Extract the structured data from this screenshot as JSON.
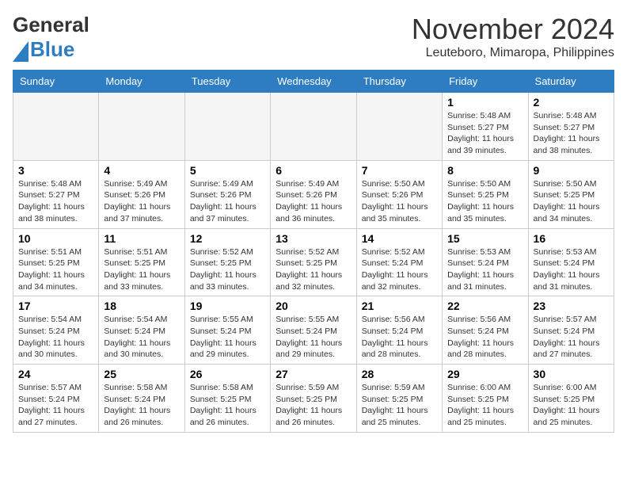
{
  "header": {
    "logo_line1": "General",
    "logo_line2": "Blue",
    "month": "November 2024",
    "location": "Leuteboro, Mimaropa, Philippines"
  },
  "days_of_week": [
    "Sunday",
    "Monday",
    "Tuesday",
    "Wednesday",
    "Thursday",
    "Friday",
    "Saturday"
  ],
  "weeks": [
    [
      {
        "day": "",
        "empty": true
      },
      {
        "day": "",
        "empty": true
      },
      {
        "day": "",
        "empty": true
      },
      {
        "day": "",
        "empty": true
      },
      {
        "day": "",
        "empty": true
      },
      {
        "day": "1",
        "sunrise": "5:48 AM",
        "sunset": "5:27 PM",
        "daylight": "11 hours and 39 minutes."
      },
      {
        "day": "2",
        "sunrise": "5:48 AM",
        "sunset": "5:27 PM",
        "daylight": "11 hours and 38 minutes."
      }
    ],
    [
      {
        "day": "3",
        "sunrise": "5:48 AM",
        "sunset": "5:27 PM",
        "daylight": "11 hours and 38 minutes."
      },
      {
        "day": "4",
        "sunrise": "5:49 AM",
        "sunset": "5:26 PM",
        "daylight": "11 hours and 37 minutes."
      },
      {
        "day": "5",
        "sunrise": "5:49 AM",
        "sunset": "5:26 PM",
        "daylight": "11 hours and 37 minutes."
      },
      {
        "day": "6",
        "sunrise": "5:49 AM",
        "sunset": "5:26 PM",
        "daylight": "11 hours and 36 minutes."
      },
      {
        "day": "7",
        "sunrise": "5:50 AM",
        "sunset": "5:26 PM",
        "daylight": "11 hours and 35 minutes."
      },
      {
        "day": "8",
        "sunrise": "5:50 AM",
        "sunset": "5:25 PM",
        "daylight": "11 hours and 35 minutes."
      },
      {
        "day": "9",
        "sunrise": "5:50 AM",
        "sunset": "5:25 PM",
        "daylight": "11 hours and 34 minutes."
      }
    ],
    [
      {
        "day": "10",
        "sunrise": "5:51 AM",
        "sunset": "5:25 PM",
        "daylight": "11 hours and 34 minutes."
      },
      {
        "day": "11",
        "sunrise": "5:51 AM",
        "sunset": "5:25 PM",
        "daylight": "11 hours and 33 minutes."
      },
      {
        "day": "12",
        "sunrise": "5:52 AM",
        "sunset": "5:25 PM",
        "daylight": "11 hours and 33 minutes."
      },
      {
        "day": "13",
        "sunrise": "5:52 AM",
        "sunset": "5:25 PM",
        "daylight": "11 hours and 32 minutes."
      },
      {
        "day": "14",
        "sunrise": "5:52 AM",
        "sunset": "5:24 PM",
        "daylight": "11 hours and 32 minutes."
      },
      {
        "day": "15",
        "sunrise": "5:53 AM",
        "sunset": "5:24 PM",
        "daylight": "11 hours and 31 minutes."
      },
      {
        "day": "16",
        "sunrise": "5:53 AM",
        "sunset": "5:24 PM",
        "daylight": "11 hours and 31 minutes."
      }
    ],
    [
      {
        "day": "17",
        "sunrise": "5:54 AM",
        "sunset": "5:24 PM",
        "daylight": "11 hours and 30 minutes."
      },
      {
        "day": "18",
        "sunrise": "5:54 AM",
        "sunset": "5:24 PM",
        "daylight": "11 hours and 30 minutes."
      },
      {
        "day": "19",
        "sunrise": "5:55 AM",
        "sunset": "5:24 PM",
        "daylight": "11 hours and 29 minutes."
      },
      {
        "day": "20",
        "sunrise": "5:55 AM",
        "sunset": "5:24 PM",
        "daylight": "11 hours and 29 minutes."
      },
      {
        "day": "21",
        "sunrise": "5:56 AM",
        "sunset": "5:24 PM",
        "daylight": "11 hours and 28 minutes."
      },
      {
        "day": "22",
        "sunrise": "5:56 AM",
        "sunset": "5:24 PM",
        "daylight": "11 hours and 28 minutes."
      },
      {
        "day": "23",
        "sunrise": "5:57 AM",
        "sunset": "5:24 PM",
        "daylight": "11 hours and 27 minutes."
      }
    ],
    [
      {
        "day": "24",
        "sunrise": "5:57 AM",
        "sunset": "5:24 PM",
        "daylight": "11 hours and 27 minutes."
      },
      {
        "day": "25",
        "sunrise": "5:58 AM",
        "sunset": "5:24 PM",
        "daylight": "11 hours and 26 minutes."
      },
      {
        "day": "26",
        "sunrise": "5:58 AM",
        "sunset": "5:25 PM",
        "daylight": "11 hours and 26 minutes."
      },
      {
        "day": "27",
        "sunrise": "5:59 AM",
        "sunset": "5:25 PM",
        "daylight": "11 hours and 26 minutes."
      },
      {
        "day": "28",
        "sunrise": "5:59 AM",
        "sunset": "5:25 PM",
        "daylight": "11 hours and 25 minutes."
      },
      {
        "day": "29",
        "sunrise": "6:00 AM",
        "sunset": "5:25 PM",
        "daylight": "11 hours and 25 minutes."
      },
      {
        "day": "30",
        "sunrise": "6:00 AM",
        "sunset": "5:25 PM",
        "daylight": "11 hours and 25 minutes."
      }
    ]
  ]
}
